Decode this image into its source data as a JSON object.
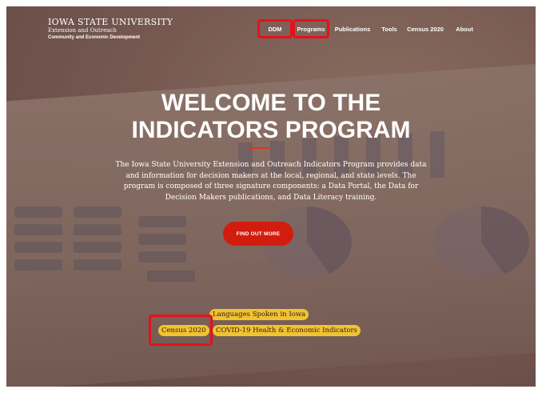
{
  "brand": {
    "university": "IOWA STATE UNIVERSITY",
    "extension": "Extension and Outreach",
    "division": "Community and Economic Development"
  },
  "nav": [
    {
      "label": "DDM",
      "highlighted": true
    },
    {
      "label": "Programs",
      "highlighted": true
    },
    {
      "label": "Publications",
      "highlighted": false
    },
    {
      "label": "Tools",
      "highlighted": false
    },
    {
      "label": "Census 2020",
      "highlighted": false
    },
    {
      "label": "About",
      "highlighted": false
    }
  ],
  "hero": {
    "title_line1": "WELCOME TO THE",
    "title_line2": "INDICATORS PROGRAM",
    "description": "The Iowa State University Extension and Outreach Indicators Program provides data and information for decision makers at the local, regional, and state levels. The program is composed of three signature components: a Data Portal, the Data for Decision Makers publications, and Data Literacy training.",
    "cta_label": "FIND OUT MORE"
  },
  "quick_links": [
    {
      "label": "Languages Spoken in Iowa"
    },
    {
      "label": "Census 2020",
      "highlighted": true
    },
    {
      "label": "COVID-19 Health & Economic Indicators"
    }
  ],
  "colors": {
    "highlight": "#e8101a",
    "cta": "#d21d0e",
    "pill": "#f2c230",
    "divider": "#e0331f"
  }
}
